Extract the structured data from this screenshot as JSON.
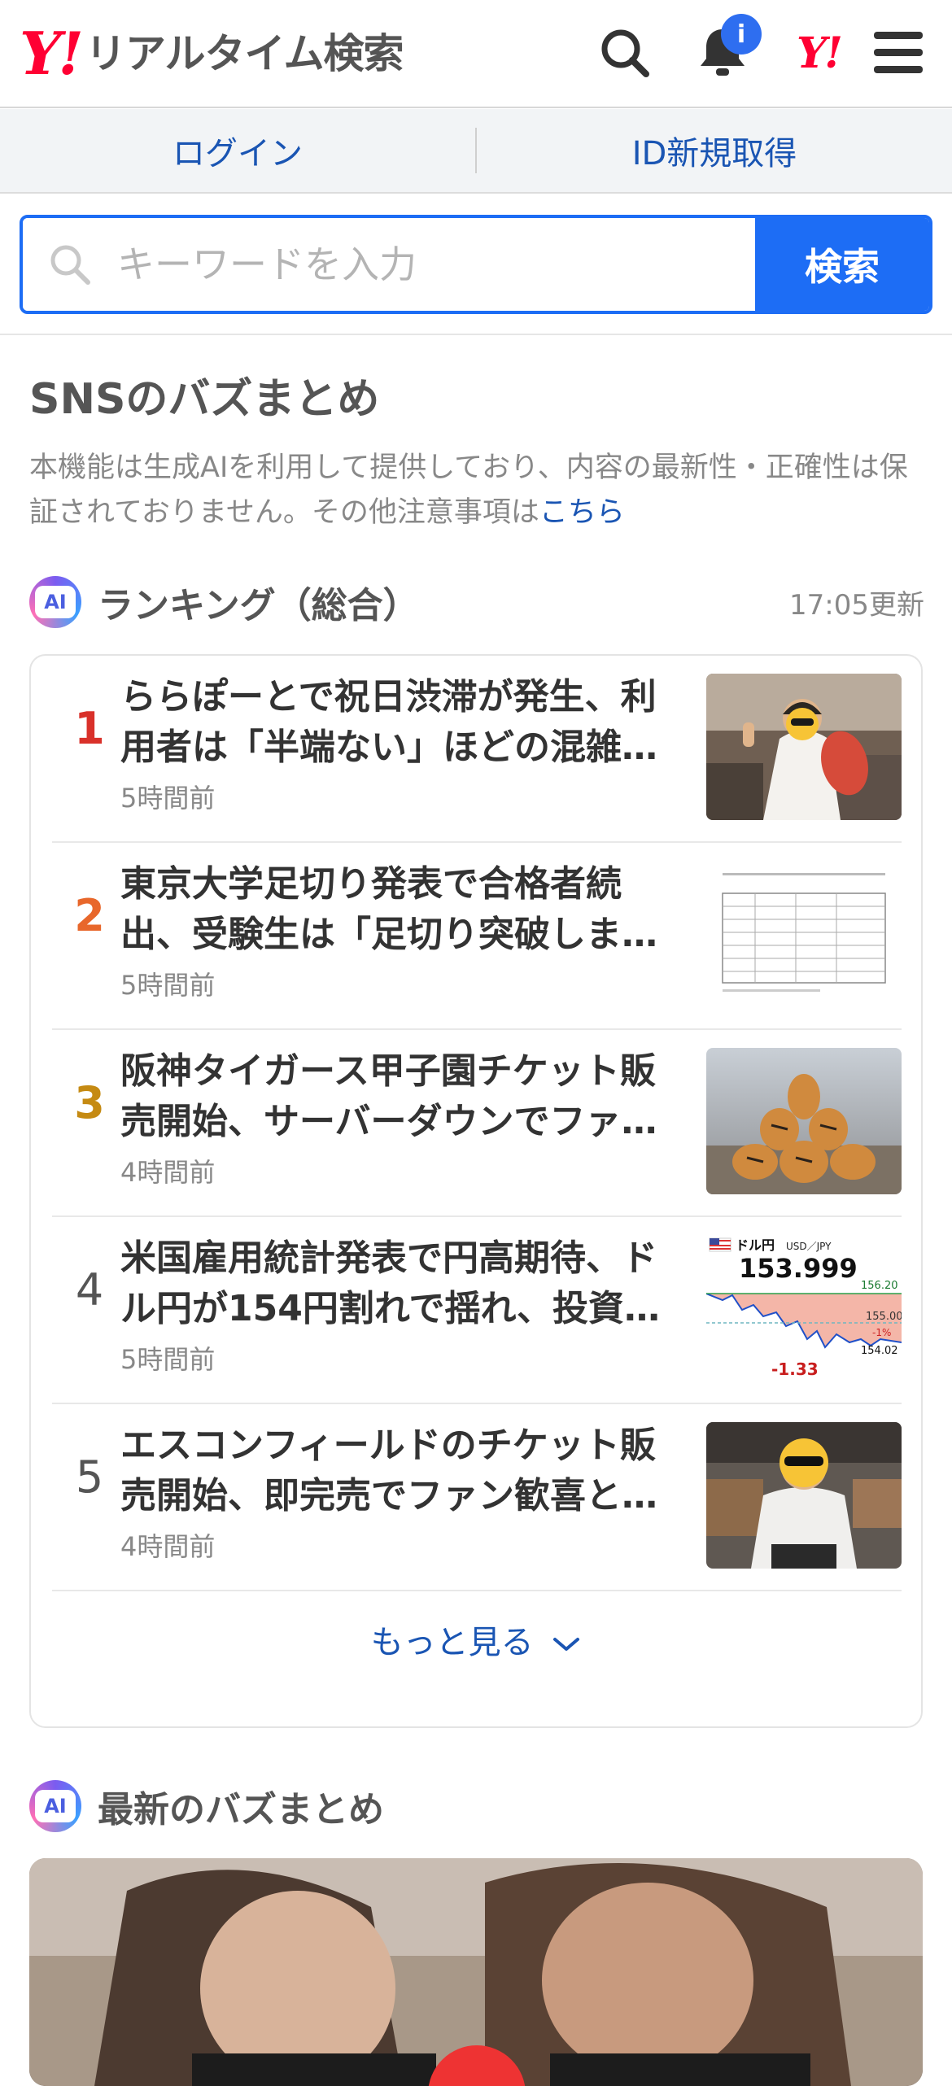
{
  "header": {
    "logo_y": "Y!",
    "logo_text": "リアルタイム検索",
    "bell_badge": "i",
    "yj_logo": "Y!"
  },
  "loginbar": {
    "login": "ログイン",
    "register": "ID新規取得"
  },
  "search": {
    "placeholder": "キーワードを入力",
    "button": "検索",
    "value": ""
  },
  "section": {
    "title": "SNSのバズまとめ",
    "notice_text": "本機能は生成AIを利用して提供しており、内容の最新性・正確性は保証されておりません。その他注意事項は",
    "notice_link": "こちら"
  },
  "ranking": {
    "ai_label": "AI",
    "title": "ランキング（総合）",
    "updated": "17:05更新",
    "items": [
      {
        "rank": "1",
        "title": "ららぽーとで祝日渋滞が発生、利用者は「半端ない」ほどの混雑…",
        "time": "5時間前",
        "rank_color": "#d9312a",
        "thumb": "person-fish-photo"
      },
      {
        "rank": "2",
        "title": "東京大学足切り発表で合格者続出、受験生は「足切り突破しま…",
        "time": "5時間前",
        "rank_color": "#e8672b",
        "thumb": "exam-table-photo"
      },
      {
        "rank": "3",
        "title": "阪神タイガース甲子園チケット販売開始、サーバーダウンでファ…",
        "time": "4時間前",
        "rank_color": "#c58a12",
        "thumb": "tigers-photo"
      },
      {
        "rank": "4",
        "title": "米国雇用統計発表で円高期待、ドル円が154円割れで揺れ、投資…",
        "time": "5時間前",
        "rank_color": "#555555",
        "thumb": "usdjpy-chart"
      },
      {
        "rank": "5",
        "title": "エスコンフィールドのチケット販売開始、即完売でファン歓喜と…",
        "time": "4時間前",
        "rank_color": "#555555",
        "thumb": "person-stadium-photo"
      }
    ],
    "more": "もっと見る"
  },
  "usdjpy_thumb": {
    "pair_label": "ドル円",
    "pair_sub": "USD／JPY",
    "price": "153.999",
    "high": "156.20",
    "mid": "155.00",
    "pct": "-1%",
    "low": "154.02",
    "change": "-1.33"
  },
  "latest": {
    "ai_label": "AI",
    "title": "最新のバズまとめ"
  }
}
